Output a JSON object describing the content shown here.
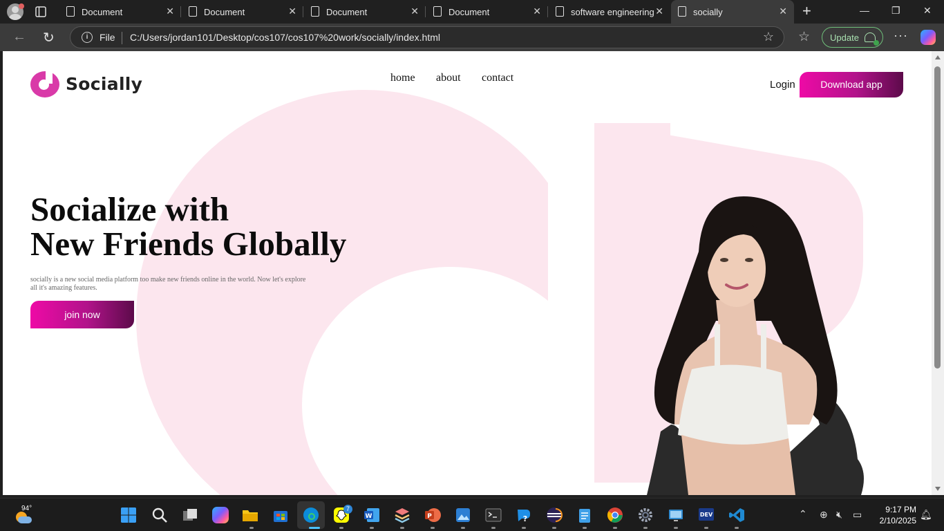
{
  "browser": {
    "tabs": [
      {
        "label": "Document"
      },
      {
        "label": "Document"
      },
      {
        "label": "Document"
      },
      {
        "label": "Document"
      },
      {
        "label": "software engineering"
      },
      {
        "label": "socially"
      }
    ],
    "address": {
      "scheme_label": "File",
      "url": "C:/Users/jordan101/Desktop/cos107/cos107%20work/socially/index.html"
    },
    "update_label": "Update",
    "window_controls": {
      "minimize": "—",
      "restore": "❐",
      "close": "✕"
    }
  },
  "page": {
    "logo_text": "Socially",
    "nav": [
      "home",
      "about",
      "contact"
    ],
    "login_label": "Login",
    "download_label": "Download app",
    "hero": {
      "title_line1": "Socialize with",
      "title_line2": "New Friends Globally",
      "description": "socially is a new social media platform too make new friends online in the world. Now let's explore all it's amazing features.",
      "cta_label": "join now"
    },
    "colors": {
      "accent_start": "#ee0aa6",
      "accent_end": "#5c0a4a",
      "background_shape": "#fce6ee",
      "logo": "#d93aa8"
    }
  },
  "taskbar": {
    "weather_temp": "94°",
    "snapchat_badge": "7",
    "apps": [
      "start-icon",
      "search-icon",
      "task-view-icon",
      "copilot-icon",
      "file-explorer-icon",
      "store-icon",
      "edge-icon",
      "snapchat-icon",
      "word-icon",
      "stack-icon",
      "powerpoint-icon",
      "photos-icon",
      "terminal-icon",
      "help-icon",
      "eclipse-icon",
      "notepad-icon",
      "chrome-icon",
      "settings-icon",
      "remote-desktop-icon",
      "devhome-icon",
      "vscode-icon"
    ],
    "time": "9:17 PM",
    "date": "2/10/2025"
  }
}
